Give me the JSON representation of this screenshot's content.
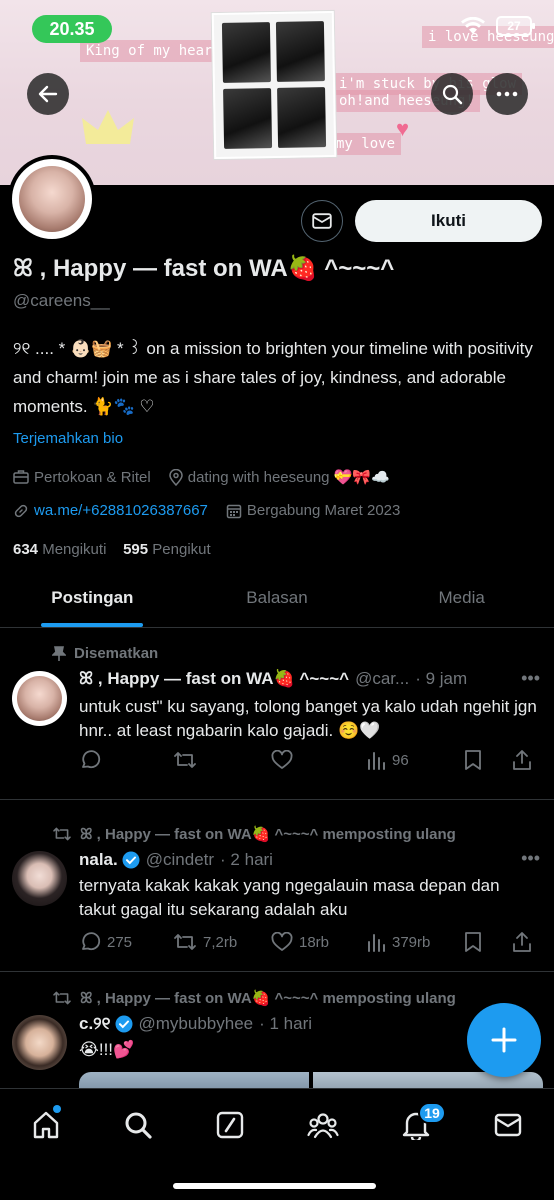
{
  "status_bar": {
    "time": "20.35",
    "battery": "27"
  },
  "banner": {
    "text_1": "King of my heart",
    "text_2": "i love heeseung",
    "text_3": "i'm stuck by his glow",
    "text_4": "oh!and heeseung!",
    "text_5": "my love"
  },
  "profile": {
    "follow_label": "Ikuti",
    "display_name": "ꕤ , Happy — fast on WA🍓 ^~~~^",
    "handle": "@careens__",
    "bio": "୨୧ .... * 👶🏻🧺 * ꒱ on a mission to brighten your timeline with positivity and charm! join me as i share tales of joy, kindness, and adorable moments. 🐈🐾 ♡",
    "translate_label": "Terjemahkan bio",
    "category": "Pertokoan & Ritel",
    "location": "dating with heeseung 💝🎀☁️",
    "website": "wa.me/+62881026387667",
    "joined": "Bergabung Maret 2023",
    "following_count": "634",
    "following_label": "Mengikuti",
    "followers_count": "595",
    "followers_label": "Pengikut"
  },
  "tabs": [
    {
      "label": "Postingan",
      "active": true
    },
    {
      "label": "Balasan",
      "active": false
    },
    {
      "label": "Media",
      "active": false
    }
  ],
  "posts": [
    {
      "context": "Disematkan",
      "name": "ꕤ , Happy — fast on WA🍓 ^~~~^",
      "handle": "@car...",
      "time": "· 9 jam",
      "text": "untuk cust\" ku sayang, tolong banget ya kalo udah ngehit jgn hnr.. at least ngabarin kalo gajadi. ☺️🤍",
      "replies": "",
      "reposts": "",
      "likes": "",
      "views": "96"
    },
    {
      "context": "ꕤ , Happy — fast on WA🍓 ^~~~^ memposting ulang",
      "name": "nala.",
      "handle": "@cindetr",
      "time": "· 2 hari",
      "text": "ternyata kakak kakak yang ngegalauin masa depan dan takut gagal itu sekarang adalah aku",
      "replies": "275",
      "reposts": "7,2rb",
      "likes": "18rb",
      "views": "379rb"
    },
    {
      "context": "ꕤ , Happy — fast on WA🍓 ^~~~^ memposting ulang",
      "name": "c.୨୧",
      "handle": "@mybubbyhee",
      "time": "· 1 hari",
      "text": "😭!!!💕"
    }
  ],
  "nav": {
    "notifications_badge": "19"
  },
  "colors": {
    "accent": "#1d9bf0",
    "background": "#000000",
    "secondary_text": "#71767b"
  }
}
